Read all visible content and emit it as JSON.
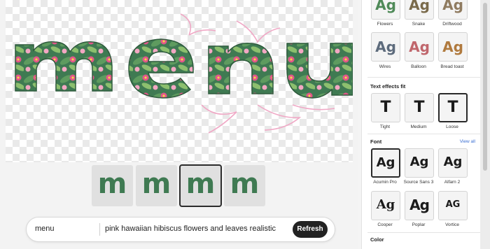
{
  "canvas": {
    "artwork_text": "menu"
  },
  "variations": [
    "m",
    "m",
    "m",
    "m"
  ],
  "prompt": {
    "text_value": "menu",
    "description_value": "pink hawaiian hibiscus flowers and leaves realistic",
    "refresh_label": "Refresh"
  },
  "styles": [
    {
      "label": "Flowers",
      "sample": "Ag"
    },
    {
      "label": "Snake",
      "sample": "Ag"
    },
    {
      "label": "Driftwood",
      "sample": "Ag"
    },
    {
      "label": "Wires",
      "sample": "Ag"
    },
    {
      "label": "Balloon",
      "sample": "Ag"
    },
    {
      "label": "Bread toast",
      "sample": "Ag"
    }
  ],
  "fit": {
    "title": "Text effects fit",
    "options": [
      {
        "label": "Tight",
        "glyph": "T"
      },
      {
        "label": "Medium",
        "glyph": "T"
      },
      {
        "label": "Loose",
        "glyph": "T"
      }
    ]
  },
  "font": {
    "title": "Font",
    "view_all": "View all",
    "options": [
      {
        "label": "Acumin Pro",
        "sample": "Ag"
      },
      {
        "label": "Source Sans 3",
        "sample": "Ag"
      },
      {
        "label": "Alfarn 2",
        "sample": "Ag"
      },
      {
        "label": "Cooper",
        "sample": "Ag"
      },
      {
        "label": "Poplar",
        "sample": "Ag"
      },
      {
        "label": "Vortice",
        "sample": "AG"
      }
    ]
  },
  "color": {
    "title": "Color"
  },
  "colors": {
    "leaf": "#3f7a52",
    "leaf_light": "#8cbf6e",
    "flower": "#e2578a",
    "flower_light": "#f3a7c3",
    "dark": "#2a2a2a"
  }
}
